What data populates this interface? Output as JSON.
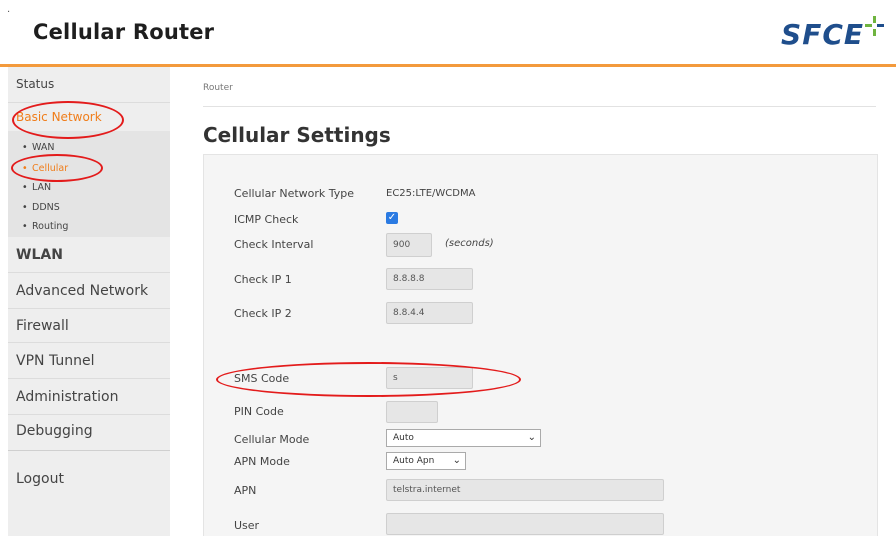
{
  "header": {
    "dot": ".",
    "title": "Cellular Router",
    "logo_text": "SFCE"
  },
  "sidebar": {
    "items": [
      {
        "label": "Status"
      },
      {
        "label": "Basic Network"
      },
      {
        "label": "WLAN"
      },
      {
        "label": "Advanced Network"
      },
      {
        "label": "Firewall"
      },
      {
        "label": "VPN Tunnel"
      },
      {
        "label": "Administration"
      },
      {
        "label": "Debugging"
      },
      {
        "label": "Logout"
      }
    ],
    "subitems": [
      {
        "label": "WAN"
      },
      {
        "label": "Cellular"
      },
      {
        "label": "LAN"
      },
      {
        "label": "DDNS"
      },
      {
        "label": "Routing"
      }
    ],
    "bullet": "•"
  },
  "breadcrumb": "Router",
  "page_title": "Cellular Settings",
  "form": {
    "network_type_label": "Cellular Network Type",
    "network_type_value": "EC25:LTE/WCDMA",
    "icmp_label": "ICMP Check",
    "icmp_checked": true,
    "check_mark": "✓",
    "interval_label": "Check Interval",
    "interval_value": "900",
    "interval_unit": "(seconds)",
    "ip1_label": "Check IP 1",
    "ip1_value": "8.8.8.8",
    "ip2_label": "Check IP 2",
    "ip2_value": "8.8.4.4",
    "sms_label": "SMS Code",
    "sms_value": "s",
    "pin_label": "PIN Code",
    "pin_value": "",
    "mode_label": "Cellular Mode",
    "mode_value": "Auto",
    "apn_mode_label": "APN Mode",
    "apn_mode_value": "Auto Apn",
    "apn_label": "APN",
    "apn_value": "telstra.internet",
    "user_label": "User",
    "user_value": "",
    "chevron": "⌄"
  },
  "colors": {
    "accent": "#f07d1a",
    "header_line": "#f39a3c",
    "annotation": "#e31b1b",
    "logo": "#1f4e8c",
    "checkbox": "#2a7ae2"
  }
}
